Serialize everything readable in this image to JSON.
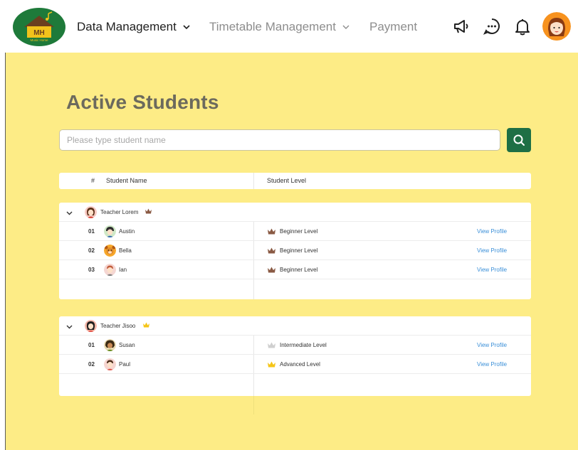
{
  "brand": {
    "logo_text": "MH",
    "logo_sub": "Music Home"
  },
  "nav": {
    "items": [
      {
        "label": "Data Management",
        "active": true,
        "has_dropdown": true
      },
      {
        "label": "Timetable Management",
        "active": false,
        "has_dropdown": true
      },
      {
        "label": "Payment",
        "active": false,
        "has_dropdown": false
      }
    ],
    "icons": [
      "megaphone-icon",
      "chat-icon",
      "bell-icon"
    ]
  },
  "page": {
    "title": "Active Students"
  },
  "search": {
    "placeholder": "Please type student name"
  },
  "table": {
    "headers": {
      "number": "#",
      "name": "Student Name",
      "level": "Student Level"
    },
    "groups": [
      {
        "teacher": "Teacher Lorem",
        "crown_color": "#8a5a44",
        "students": [
          {
            "num": "01",
            "name": "Austin",
            "level": "Beginner Level",
            "crown_color": "#8a5a44",
            "action": "View Profile"
          },
          {
            "num": "02",
            "name": "Bella",
            "level": "Beginner Level",
            "crown_color": "#8a5a44",
            "action": "View Profile"
          },
          {
            "num": "03",
            "name": "Ian",
            "level": "Beginner Level",
            "crown_color": "#8a5a44",
            "action": "View Profile"
          }
        ]
      },
      {
        "teacher": "Teacher Jisoo",
        "crown_color": "#f5c518",
        "students": [
          {
            "num": "01",
            "name": "Susan",
            "level": "Intermediate Level",
            "crown_color": "#cfcfcf",
            "action": "View Profile"
          },
          {
            "num": "02",
            "name": "Paul",
            "level": "Advanced Level",
            "crown_color": "#f5c518",
            "action": "View Profile"
          }
        ]
      }
    ]
  },
  "colors": {
    "background": "#fdec86",
    "accent": "#1e6f45",
    "link": "#3a8fd8",
    "title": "#6c6a5d"
  }
}
